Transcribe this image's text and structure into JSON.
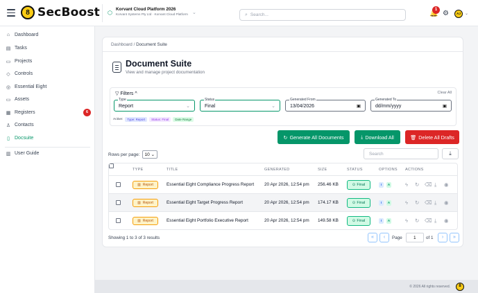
{
  "app": {
    "logo_text": "SecBoost",
    "logo_glyph": "8"
  },
  "org": {
    "name": "Korvant Cloud Platform 2026",
    "subtitle": "Korvant Systems Pty Ltd · Korvant Cloud Platform"
  },
  "search": {
    "placeholder": "Search..."
  },
  "notifications": {
    "count": "1"
  },
  "user": {
    "initials": "AJ"
  },
  "sidebar": {
    "items": [
      {
        "label": "Dashboard",
        "icon": "home-icon"
      },
      {
        "label": "Tasks",
        "icon": "clipboard-icon"
      },
      {
        "label": "Projects",
        "icon": "briefcase-icon"
      },
      {
        "label": "Controls",
        "icon": "shield-icon"
      },
      {
        "label": "Essential Eight",
        "icon": "target-icon"
      },
      {
        "label": "Assets",
        "icon": "monitor-icon"
      },
      {
        "label": "Registers",
        "icon": "register-icon",
        "badge": "6"
      },
      {
        "label": "Contacts",
        "icon": "person-icon"
      },
      {
        "label": "Docsuite",
        "icon": "document-icon",
        "active": true
      },
      {
        "label": "User Guide",
        "icon": "book-icon"
      }
    ]
  },
  "breadcrumb": {
    "root": "Dashboard",
    "separator": "/",
    "current": "Document Suite"
  },
  "page": {
    "title": "Document Suite",
    "subtitle": "View and manage project documentation"
  },
  "filters": {
    "heading": "Filters",
    "clear_all": "Clear All",
    "type": {
      "label": "Type",
      "value": "Report"
    },
    "status": {
      "label": "Status",
      "value": "Final"
    },
    "generated_from": {
      "label": "Generated From",
      "value": "13/04/2026"
    },
    "generated_to": {
      "label": "Generated To",
      "value": "dd/mm/yyyy"
    },
    "active_label": "Active:",
    "active_chips": {
      "type": "Type: Report",
      "status": "Status: Final",
      "date": "Date Range"
    }
  },
  "actions": {
    "generate_all": "Generate All Documents",
    "download_all": "Download All",
    "delete_drafts": "Delete All Drafts"
  },
  "table_controls": {
    "rows_per_page_label": "Rows per page:",
    "rows_per_page_value": "10",
    "search_placeholder": "Search"
  },
  "table": {
    "headers": {
      "type": "TYPE",
      "title": "TITLE",
      "generated": "GENERATED",
      "size": "SIZE",
      "status": "STATUS",
      "options": "OPTIONS",
      "actions": "ACTIONS"
    },
    "rows": [
      {
        "type": "Report",
        "title": "Essential Eight Compliance Progress Report",
        "generated": "20 Apr 2026, 12:54 pm",
        "size": "256.46 KB",
        "status": "Final",
        "opt_i": "I",
        "opt_a": "A"
      },
      {
        "type": "Report",
        "title": "Essential Eight Target Progress Report",
        "generated": "20 Apr 2026, 12:54 pm",
        "size": "174.17 KB",
        "status": "Final",
        "opt_i": "I",
        "opt_a": "A"
      },
      {
        "type": "Report",
        "title": "Essential Eight Portfolio Executive Report",
        "generated": "20 Apr 2026, 12:54 pm",
        "size": "149.58 KB",
        "status": "Final",
        "opt_i": "I",
        "opt_a": "A"
      }
    ]
  },
  "pagination": {
    "showing": "Showing 1 to 3 of 3 results",
    "page_label": "Page",
    "page_value": "1",
    "of_label": "of 1"
  },
  "footer": {
    "text": "© 2026 All rights reserved."
  },
  "colors": {
    "accent": "#059669",
    "danger": "#dc2626",
    "brand": "#facc15"
  }
}
